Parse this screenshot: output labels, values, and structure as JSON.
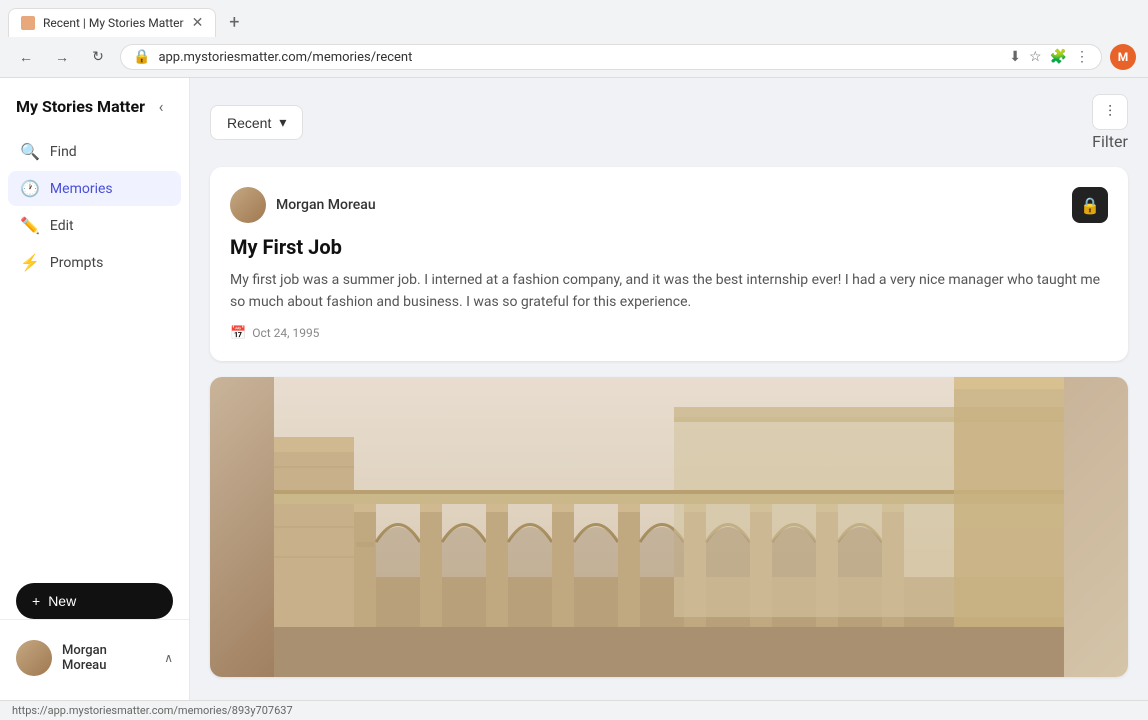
{
  "browser": {
    "tab_title": "Recent | My Stories Matter",
    "tab_favicon_letter": "M",
    "url": "app.mystoriesmatter.com/memories/recent",
    "new_tab_icon": "+",
    "nav_back": "←",
    "nav_forward": "→",
    "nav_refresh": "↻",
    "profile_initial": "M",
    "status_url": "https://app.mystoriesmatter.com/memories/893y707637"
  },
  "sidebar": {
    "title": "My Stories Matter",
    "collapse_icon": "‹",
    "nav_items": [
      {
        "id": "find",
        "label": "Find",
        "icon": "🔍",
        "active": false
      },
      {
        "id": "memories",
        "label": "Memories",
        "icon": "🕐",
        "active": true
      },
      {
        "id": "edit",
        "label": "Edit",
        "icon": "✏️",
        "active": false
      },
      {
        "id": "prompts",
        "label": "Prompts",
        "icon": "⚡",
        "active": false
      }
    ],
    "new_button_label": "New",
    "new_icon": "+",
    "user": {
      "name_line1": "Morgan",
      "name_line2": "Moreau",
      "full_name": "Morgan Moreau",
      "chevron": "∧"
    }
  },
  "main": {
    "dropdown_label": "Recent",
    "dropdown_icon": "▾",
    "filter_label": "Filter",
    "filter_icon": "≡"
  },
  "story_card": {
    "author_name": "Morgan Moreau",
    "title": "My First Job",
    "body": "My first job was a summer job. I interned at a fashion company, and it was the best internship ever! I had a very nice manager who taught me so much about fashion and business. I was so grateful for this experience.",
    "date": "Oct 24, 1995",
    "lock_icon": "🔒"
  },
  "colors": {
    "accent": "#4a4fd8",
    "dark": "#111111",
    "sidebar_bg": "#ffffff",
    "main_bg": "#f0f2f5",
    "card_bg": "#ffffff",
    "new_btn_bg": "#111111",
    "author_avatar_bg": "#c4a882",
    "lock_bg": "#222222"
  }
}
